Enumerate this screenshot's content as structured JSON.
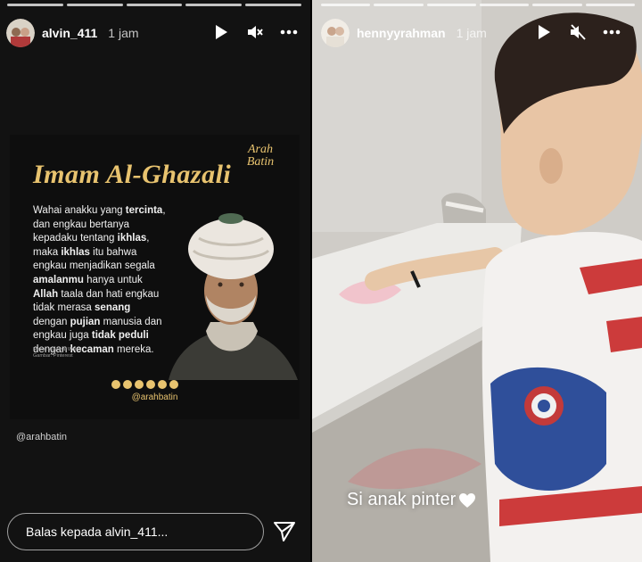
{
  "left_story": {
    "username": "alvin_411",
    "time": "1 jam",
    "icons": {
      "play": "play-icon",
      "mute": "volume-mute-icon",
      "more": "more-horizontal-icon"
    },
    "card": {
      "title": "Imam Al-Ghazali",
      "logo_line1": "Arah",
      "logo_line2": "Batin",
      "lines": [
        {
          "pre": "Wahai anakku yang ",
          "bold": "tercinta",
          "post": ","
        },
        {
          "pre": "dan engkau bertanya",
          "bold": "",
          "post": ""
        },
        {
          "pre": "kepadaku tentang ",
          "bold": "ikhlas",
          "post": ","
        },
        {
          "pre": "maka ",
          "bold": "ikhlas",
          "post": " itu bahwa"
        },
        {
          "pre": "engkau menjadikan segala",
          "bold": "",
          "post": ""
        },
        {
          "pre": "",
          "bold": "amalanmu",
          "post": " hanya untuk"
        },
        {
          "pre": "",
          "bold": "Allah",
          "post": " taala dan hati engkau"
        },
        {
          "pre": "tidak merasa ",
          "bold": "senang",
          "post": ""
        },
        {
          "pre": "dengan ",
          "bold": "pujian",
          "post": " manusia dan"
        },
        {
          "pre": "engkau juga ",
          "bold": "tidak peduli",
          "post": ""
        },
        {
          "pre": "dengan ",
          "bold": "kecaman",
          "post": " mereka."
        }
      ],
      "meta_line1": "Materi: Ayyuhal Walad",
      "meta_line2": "Gambar: Pinterest",
      "social_icons": [
        "instagram-icon",
        "twitter-icon",
        "youtube-icon",
        "facebook-icon",
        "telegram-icon",
        "tiktok-icon"
      ],
      "handle": "@arahbatin"
    },
    "mention": "@arahbatin",
    "reply_placeholder": "Balas kepada alvin_411...",
    "send_icon": "send-icon"
  },
  "right_story": {
    "username": "hennyyrahman",
    "time": "1 jam",
    "icons": {
      "play": "play-icon",
      "mute": "volume-mute-icon",
      "more": "more-horizontal-icon"
    },
    "caption": "Si anak pinter",
    "caption_icon": "heart-icon"
  },
  "colors": {
    "accent_gold": "#e8c36f",
    "card_bg": "#0e0e0e",
    "panel_bg": "#121212"
  }
}
